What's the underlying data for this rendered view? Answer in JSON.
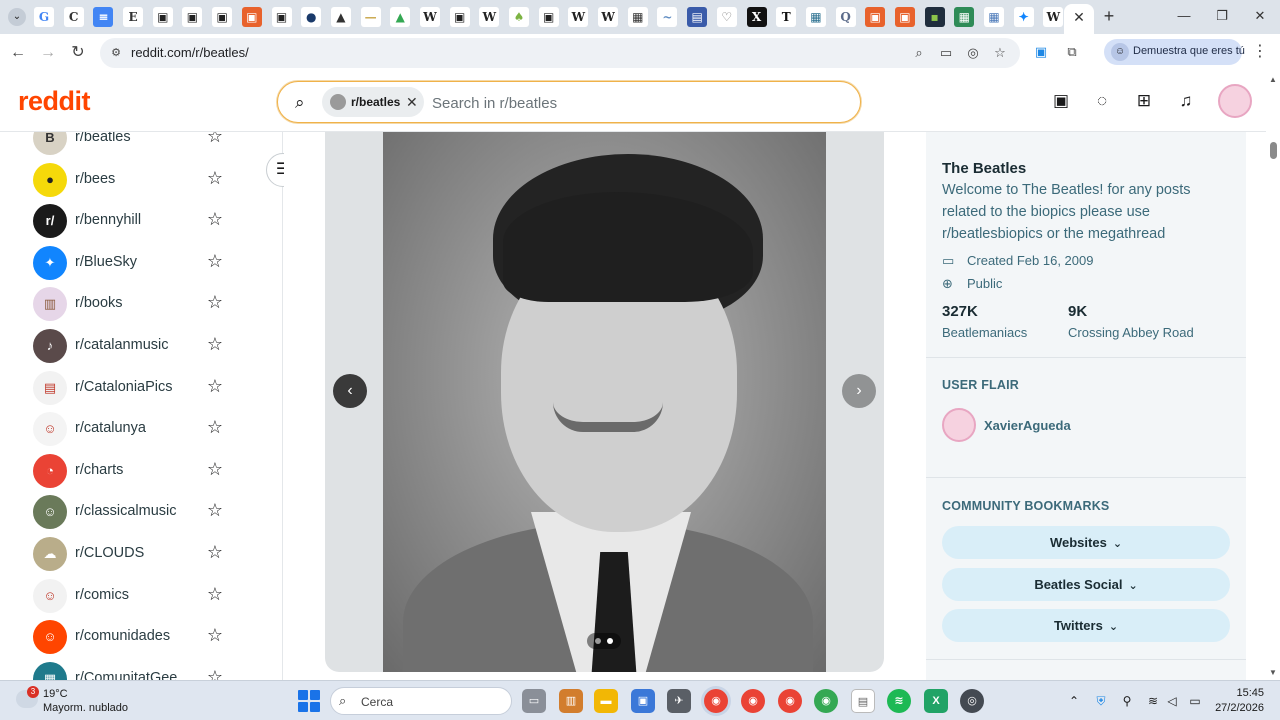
{
  "browser": {
    "url": "reddit.com/r/beatles/",
    "profile_label": "Demuestra que eres tú",
    "favicons": [
      {
        "icon": "google-icon",
        "glyph": "G",
        "color": "#4285f4",
        "bg": "#ffffff"
      },
      {
        "icon": "c-icon",
        "glyph": "C",
        "color": "#333333",
        "bg": "#ffffff"
      },
      {
        "icon": "docs-icon",
        "glyph": "≡",
        "color": "#ffffff",
        "bg": "#4285f4"
      },
      {
        "icon": "e-icon",
        "glyph": "E",
        "color": "#333333",
        "bg": "#ffffff"
      },
      {
        "icon": "page-icon",
        "glyph": "▣",
        "color": "#222222",
        "bg": "#ffffff"
      },
      {
        "icon": "page-icon",
        "glyph": "▣",
        "color": "#222222",
        "bg": "#ffffff"
      },
      {
        "icon": "page-icon",
        "glyph": "▣",
        "color": "#222222",
        "bg": "#ffffff"
      },
      {
        "icon": "orange-icon",
        "glyph": "▣",
        "color": "#ffffff",
        "bg": "#e8622c"
      },
      {
        "icon": "page-icon",
        "glyph": "▣",
        "color": "#222222",
        "bg": "#ffffff"
      },
      {
        "icon": "circle-icon",
        "glyph": "●",
        "color": "#1a3a6a",
        "bg": "#ffffff"
      },
      {
        "icon": "temple-icon",
        "glyph": "▲",
        "color": "#333333",
        "bg": "#ffffff"
      },
      {
        "icon": "dash-icon",
        "glyph": "—",
        "color": "#c9a64a",
        "bg": "#ffffff"
      },
      {
        "icon": "drive-icon",
        "glyph": "▲",
        "color": "#34a853",
        "bg": "#ffffff"
      },
      {
        "icon": "wikipedia-icon",
        "glyph": "W",
        "color": "#222222",
        "bg": "#ffffff"
      },
      {
        "icon": "page-icon",
        "glyph": "▣",
        "color": "#222222",
        "bg": "#ffffff"
      },
      {
        "icon": "wikipedia-icon",
        "glyph": "W",
        "color": "#222222",
        "bg": "#ffffff"
      },
      {
        "icon": "leaf-icon",
        "glyph": "♠",
        "color": "#7cb342",
        "bg": "#ffffff"
      },
      {
        "icon": "page-icon",
        "glyph": "▣",
        "color": "#222222",
        "bg": "#ffffff"
      },
      {
        "icon": "wikipedia-icon",
        "glyph": "W",
        "color": "#222222",
        "bg": "#ffffff"
      },
      {
        "icon": "wikipedia-icon",
        "glyph": "W",
        "color": "#222222",
        "bg": "#ffffff"
      },
      {
        "icon": "picture-icon",
        "glyph": "▦",
        "color": "#333333",
        "bg": "#ffffff"
      },
      {
        "icon": "wave-icon",
        "glyph": "~",
        "color": "#5f8cc2",
        "bg": "#ffffff"
      },
      {
        "icon": "calendar-icon",
        "glyph": "▤",
        "color": "#ffffff",
        "bg": "#3a5ba9"
      },
      {
        "icon": "heart-icon",
        "glyph": "♡",
        "color": "#666666",
        "bg": "#ffffff"
      },
      {
        "icon": "x-icon",
        "glyph": "X",
        "color": "#ffffff",
        "bg": "#111111"
      },
      {
        "icon": "nyt-icon",
        "glyph": "T",
        "color": "#111111",
        "bg": "#ffffff"
      },
      {
        "icon": "photo-icon",
        "glyph": "▦",
        "color": "#2a6f8f",
        "bg": "#ffffff"
      },
      {
        "icon": "q-icon",
        "glyph": "Q",
        "color": "#5b6b8a",
        "bg": "#ffffff"
      },
      {
        "icon": "orange-icon",
        "glyph": "▣",
        "color": "#ffffff",
        "bg": "#e8622c"
      },
      {
        "icon": "orange-icon",
        "glyph": "▣",
        "color": "#ffffff",
        "bg": "#e8622c"
      },
      {
        "icon": "dark-icon",
        "glyph": "▪",
        "color": "#8bc34a",
        "bg": "#1f2d3d"
      },
      {
        "icon": "sheet-icon",
        "glyph": "▦",
        "color": "#ffffff",
        "bg": "#2e8b57"
      },
      {
        "icon": "map-icon",
        "glyph": "▦",
        "color": "#4a78b8",
        "bg": "#ffffff"
      },
      {
        "icon": "bluesky-icon",
        "glyph": "✦",
        "color": "#1185fe",
        "bg": "#ffffff"
      },
      {
        "icon": "wikipedia-icon",
        "glyph": "W",
        "color": "#222222",
        "bg": "#ffffff"
      }
    ]
  },
  "reddit": {
    "logo": "reddit",
    "search": {
      "chip_label": "r/beatles",
      "placeholder": "Search in r/beatles"
    }
  },
  "sidebar": {
    "items": [
      {
        "label": "r/beatles",
        "bg": "#d8d2c4",
        "glyph": "B",
        "color": "#333333"
      },
      {
        "label": "r/bees",
        "bg": "#f5d90a",
        "glyph": "●",
        "color": "#222222"
      },
      {
        "label": "r/bennyhill",
        "bg": "#1a1a1a",
        "glyph": "r/",
        "color": "#ffffff"
      },
      {
        "label": "r/BlueSky",
        "bg": "#1185fe",
        "glyph": "✦",
        "color": "#ffffff"
      },
      {
        "label": "r/books",
        "bg": "#e6d6e8",
        "glyph": "▥",
        "color": "#8a5a3c"
      },
      {
        "label": "r/catalanmusic",
        "bg": "#5a4a4a",
        "glyph": "♪",
        "color": "#ffffff"
      },
      {
        "label": "r/CataloniaPics",
        "bg": "#f2f2f2",
        "glyph": "▤",
        "color": "#c0392b"
      },
      {
        "label": "r/catalunya",
        "bg": "#f4f4f4",
        "glyph": "☺",
        "color": "#c0392b"
      },
      {
        "label": "r/charts",
        "bg": "#ea4335",
        "glyph": "◔",
        "color": "#ffffff"
      },
      {
        "label": "r/classicalmusic",
        "bg": "#6a7a5a",
        "glyph": "☺",
        "color": "#ffffff"
      },
      {
        "label": "r/CLOUDS",
        "bg": "#b9ad8a",
        "glyph": "☁",
        "color": "#ffffff"
      },
      {
        "label": "r/comics",
        "bg": "#f2f2f2",
        "glyph": "☺",
        "color": "#c0392b"
      },
      {
        "label": "r/comunidades",
        "bg": "#ff4500",
        "glyph": "☺",
        "color": "#ffffff"
      },
      {
        "label": "r/ComunitatGee",
        "bg": "#1f7a8c",
        "glyph": "▦",
        "color": "#ffffff"
      }
    ]
  },
  "community": {
    "title": "The Beatles",
    "description": "Welcome to The Beatles! for any posts related to the biopics please use r/beatlesbiopics or the megathread",
    "created": "Created Feb 16, 2009",
    "visibility": "Public",
    "stats": [
      {
        "value": "327K",
        "label": "Beatlemaniacs"
      },
      {
        "value": "9K",
        "label": "Crossing Abbey Road"
      }
    ],
    "user_flair_heading": "USER FLAIR",
    "user_flair_name": "XavierAgueda",
    "bookmarks_heading": "COMMUNITY BOOKMARKS",
    "bookmarks": [
      "Websites",
      "Beatles Social",
      "Twitters"
    ]
  },
  "gallery": {
    "image_count": 2,
    "current_index": 1
  },
  "taskbar": {
    "weather_temp": "19°C",
    "weather_desc": "Mayorm. nublado",
    "weather_badge": "3",
    "search_label": "Cerca",
    "time": "15:45",
    "date": "27/2/2026"
  },
  "colors": {
    "reddit_orange": "#ff4500",
    "sidebar_text": "#2a3c42",
    "panel_text": "#3c6a7a",
    "bookmark_bg": "#d9eef8"
  }
}
